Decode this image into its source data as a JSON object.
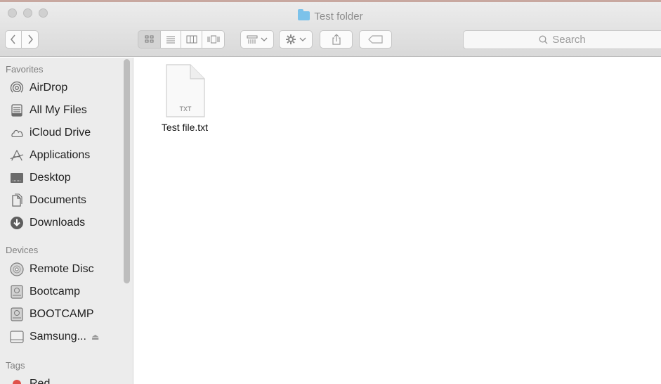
{
  "window": {
    "title": "Test folder"
  },
  "toolbar": {
    "back_icon": "chevron-left-icon",
    "forward_icon": "chevron-right-icon",
    "view_modes": [
      "icon-view-icon",
      "list-view-icon",
      "column-view-icon",
      "cover-flow-icon"
    ],
    "active_view": "icon-view-icon",
    "search": {
      "placeholder": "Search"
    }
  },
  "sidebar": {
    "favorites_title": "Favorites",
    "favorites": [
      {
        "label": "AirDrop",
        "icon": "airdrop-icon"
      },
      {
        "label": "All My Files",
        "icon": "all-files-icon"
      },
      {
        "label": "iCloud Drive",
        "icon": "cloud-icon"
      },
      {
        "label": "Applications",
        "icon": "applications-icon"
      },
      {
        "label": "Desktop",
        "icon": "desktop-icon"
      },
      {
        "label": "Documents",
        "icon": "documents-icon"
      },
      {
        "label": "Downloads",
        "icon": "downloads-icon"
      }
    ],
    "devices_title": "Devices",
    "devices": [
      {
        "label": "Remote Disc",
        "icon": "disc-icon"
      },
      {
        "label": "Bootcamp",
        "icon": "drive-icon"
      },
      {
        "label": "BOOTCAMP",
        "icon": "drive-icon"
      },
      {
        "label": "Samsung...",
        "icon": "external-drive-icon",
        "eject": "⏏"
      }
    ],
    "tags_title": "Tags",
    "tags": [
      {
        "label": "Red",
        "color": "#e0514a"
      }
    ]
  },
  "content": {
    "files": [
      {
        "name": "Test file.txt",
        "type_label": "TXT",
        "icon": "text-file-icon"
      }
    ]
  }
}
